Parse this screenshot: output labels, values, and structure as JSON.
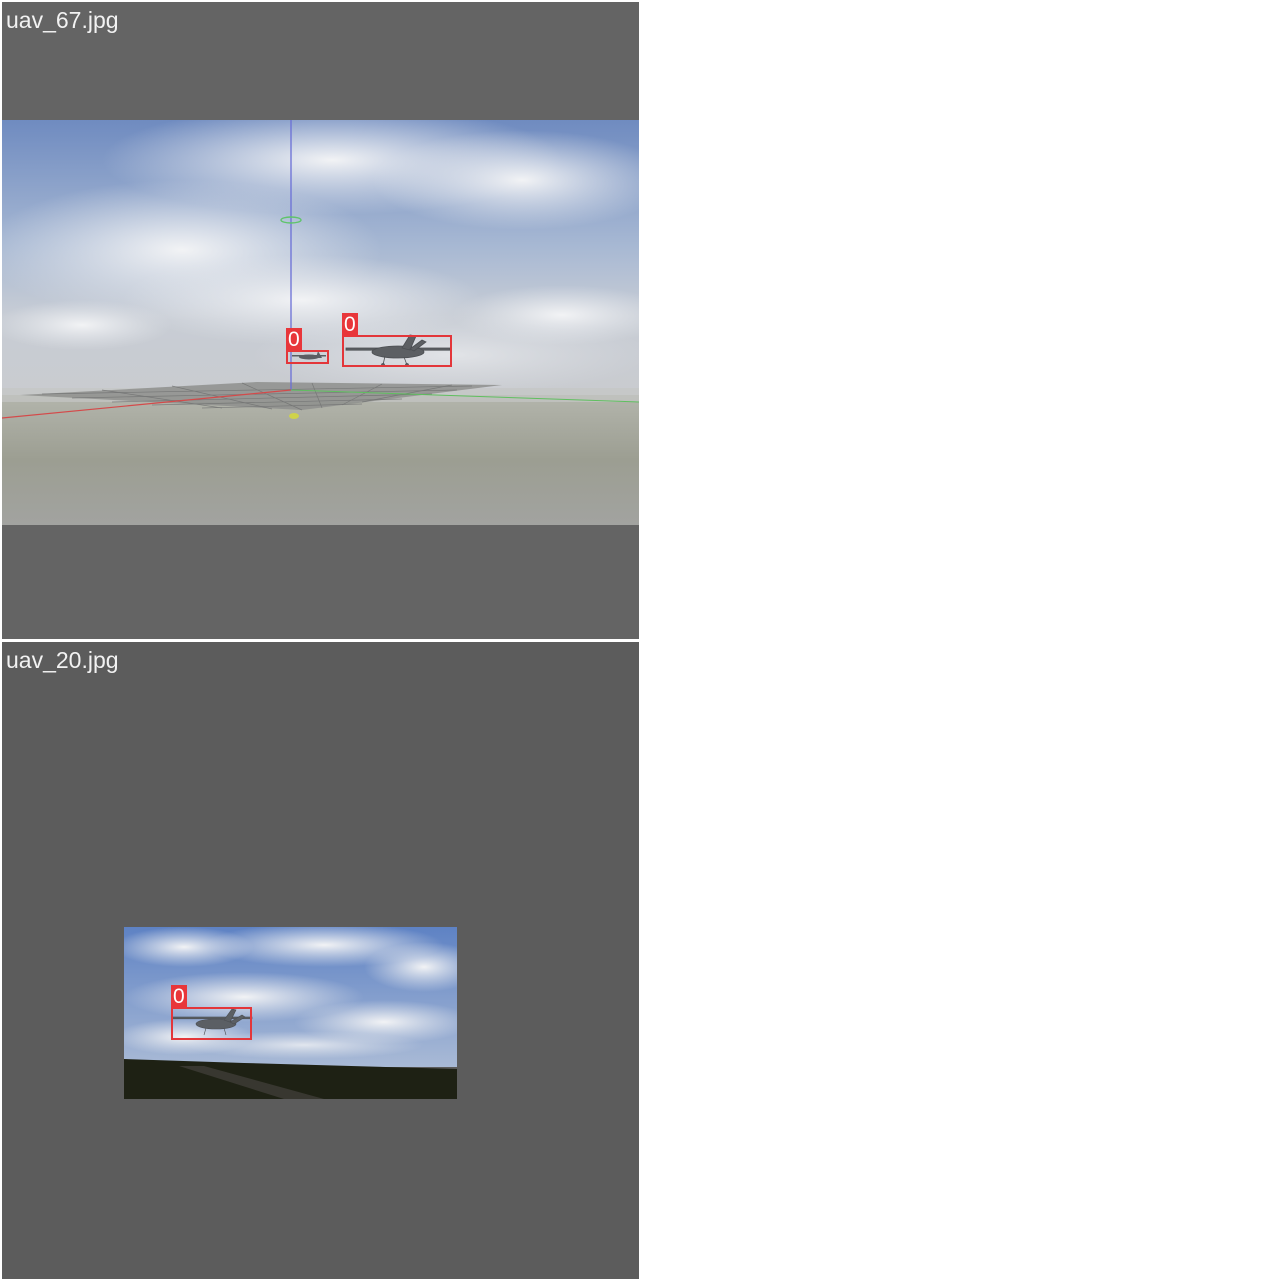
{
  "tiles": [
    {
      "filename": "uav_67.jpg",
      "detections": [
        {
          "class_label": "0"
        },
        {
          "class_label": "0"
        }
      ]
    },
    {
      "filename": "uav_20.jpg",
      "detections": [
        {
          "class_label": "0"
        }
      ]
    }
  ],
  "colors": {
    "bbox": "#e3363a",
    "label_bg": "#e8363a",
    "letterbox_grey": "#646464",
    "text": "#f2f2f2"
  }
}
